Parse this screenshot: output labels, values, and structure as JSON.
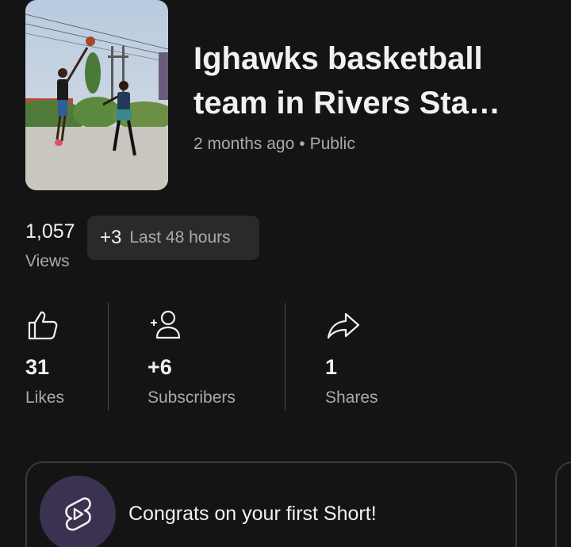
{
  "video": {
    "title": "Ighawks basketball\nteam in Rivers Sta…",
    "age": "2 months ago",
    "visibility": "Public",
    "separator": "•"
  },
  "views": {
    "count": "1,057",
    "label": "Views",
    "delta": "+3",
    "period": "Last 48 hours"
  },
  "stats": {
    "likes": {
      "value": "31",
      "label": "Likes",
      "icon": "thumbs-up-icon"
    },
    "subscribers": {
      "value": "+6",
      "label": "Subscribers",
      "icon": "add-person-icon"
    },
    "shares": {
      "value": "1",
      "label": "Shares",
      "icon": "share-arrow-icon"
    }
  },
  "card": {
    "text": "Congrats on your first Short!",
    "icon": "shorts-logo-icon"
  },
  "colors": {
    "background": "#141414",
    "chip": "#2a2a2a",
    "badge": "#3a3250",
    "secondary_text": "#aaaaaa"
  }
}
